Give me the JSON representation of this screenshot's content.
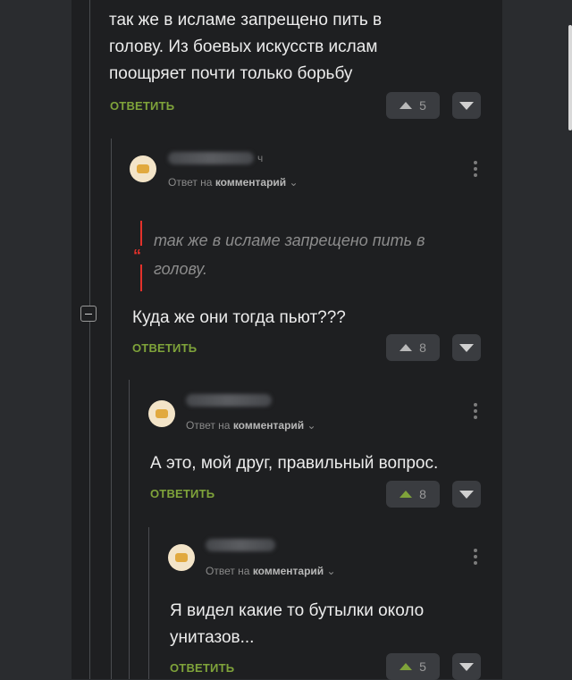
{
  "comment_top": {
    "text_line1": "так же в исламе запрещено пить в",
    "text_line2": "голову. Из боевых искусств ислам",
    "text_line3": "поощряет почти только борьбу",
    "reply_label": "ОТВЕТИТЬ",
    "votes": "5"
  },
  "comment_2": {
    "time": "ч",
    "reply_to_prefix": "Ответ на",
    "reply_to_target": "комментарий",
    "quote_line1": "так же в исламе запрещено пить в",
    "quote_line2": "голову.",
    "quote_glyph": "“",
    "text": "Куда же они тогда пьют???",
    "reply_label": "ОТВЕТИТЬ",
    "votes": "8"
  },
  "comment_3": {
    "reply_to_prefix": "Ответ на",
    "reply_to_target": "комментарий",
    "text": "А это, мой друг, правильный вопрос.",
    "reply_label": "ОТВЕТИТЬ",
    "votes": "8"
  },
  "comment_4": {
    "reply_to_prefix": "Ответ на",
    "reply_to_target": "комментарий",
    "text_line1": "Я видел какие то бутылки около",
    "text_line2": "унитазов...",
    "reply_label": "ОТВЕТИТЬ",
    "votes": "5"
  },
  "icons": {
    "chevron": "⌄"
  },
  "colors": {
    "accent_green": "#7fa33a",
    "quote_red": "#e4322b",
    "background": "#1e1f21"
  }
}
